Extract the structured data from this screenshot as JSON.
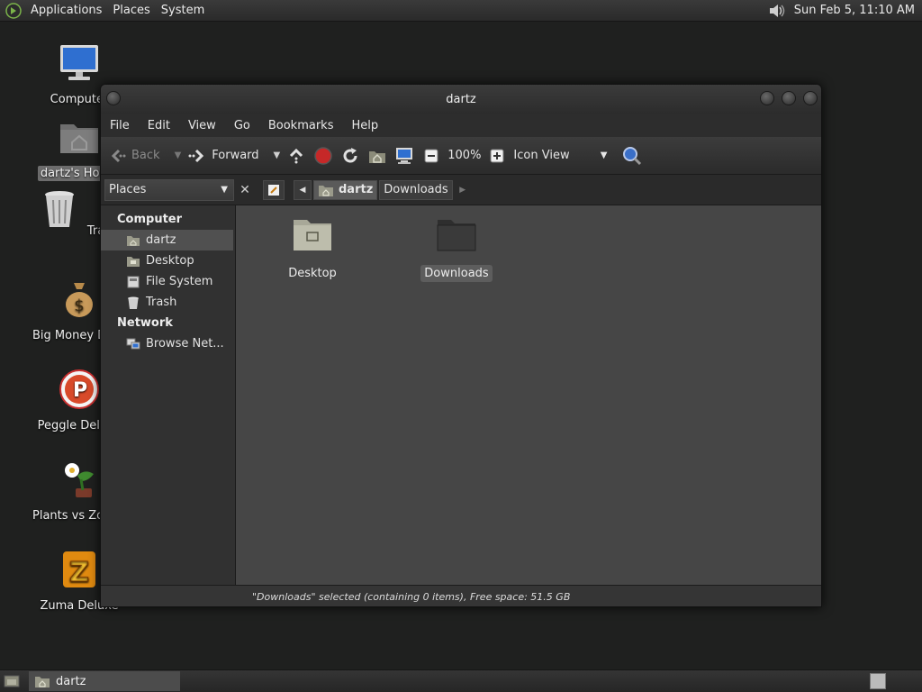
{
  "top_panel": {
    "menus": [
      "Applications",
      "Places",
      "System"
    ],
    "clock": "Sun Feb  5, 11:10 AM"
  },
  "desktop_icons": [
    {
      "label": "Computer",
      "icon": "computer-icon"
    },
    {
      "label": "dartz's Home",
      "icon": "home-folder-icon",
      "selected": true
    },
    {
      "label": "Trash",
      "icon": "trash-icon"
    },
    {
      "label": "Big Money Deluxe",
      "icon": "money-bag-icon"
    },
    {
      "label": "Peggle Deluxe",
      "icon": "peggle-icon"
    },
    {
      "label": "Plants vs Zombies",
      "icon": "plant-icon"
    },
    {
      "label": "Zuma Deluxe",
      "icon": "zuma-icon"
    }
  ],
  "window": {
    "title": "dartz",
    "menubar": [
      "File",
      "Edit",
      "View",
      "Go",
      "Bookmarks",
      "Help"
    ],
    "toolbar": {
      "back": "Back",
      "forward": "Forward",
      "zoom": "100%",
      "view_mode": "Icon View"
    },
    "location": {
      "places_label": "Places",
      "crumbs": [
        "dartz",
        "Downloads"
      ]
    },
    "sidebar": {
      "computer_header": "Computer",
      "computer_items": [
        "dartz",
        "Desktop",
        "File System",
        "Trash"
      ],
      "network_header": "Network",
      "network_items": [
        "Browse Net..."
      ]
    },
    "files": [
      {
        "label": "Desktop",
        "icon": "desktop-folder-icon"
      },
      {
        "label": "Downloads",
        "icon": "folder-icon",
        "selected": true
      }
    ],
    "status": "\"Downloads\" selected (containing 0 items), Free space: 51.5 GB"
  },
  "bottom_panel": {
    "task_label": "dartz"
  },
  "colors": {
    "panel_bg": "#2a2a2a",
    "content_bg": "#464646",
    "accent_red": "#c62828",
    "search_blue": "#2f6fd0"
  }
}
